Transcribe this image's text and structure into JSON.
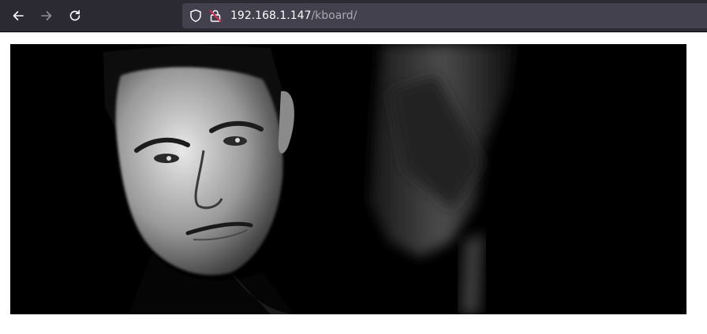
{
  "browser": {
    "url_host": "192.168.1.147",
    "url_path": "/kboard/",
    "icons": {
      "back": "arrow-left-icon",
      "forward": "arrow-right-icon",
      "reload": "reload-icon",
      "shield": "shield-icon",
      "lock": "insecure-lock-icon"
    },
    "colors": {
      "toolbar": "#2b2a33",
      "urlbar": "#42414d",
      "insecure_lock": "#e22850"
    }
  },
  "page": {
    "banner_image": "black-and-white-portrait-photo"
  }
}
